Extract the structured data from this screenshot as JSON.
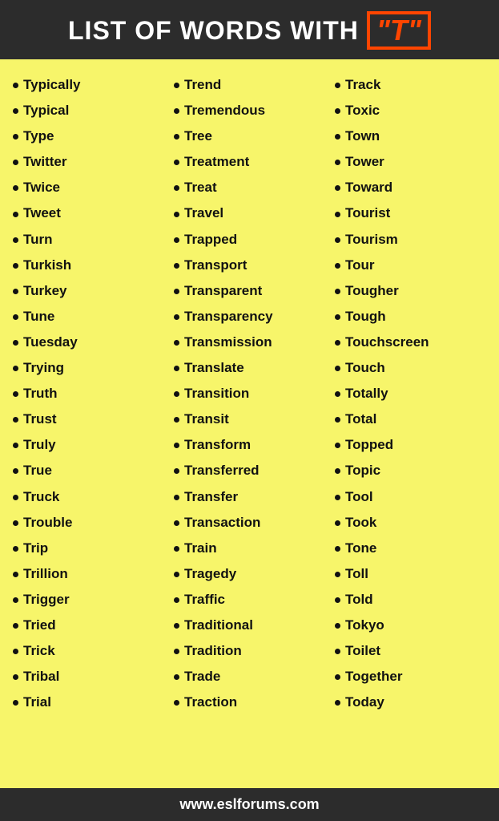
{
  "header": {
    "title": "LIST OF WORDS WITH",
    "letter": "\"T\""
  },
  "columns": [
    {
      "words": [
        "Typically",
        "Typical",
        "Type",
        "Twitter",
        "Twice",
        "Tweet",
        "Turn",
        "Turkish",
        "Turkey",
        "Tune",
        "Tuesday",
        "Trying",
        "Truth",
        "Trust",
        "Truly",
        "True",
        "Truck",
        "Trouble",
        "Trip",
        "Trillion",
        "Trigger",
        "Tried",
        "Trick",
        "Tribal",
        "Trial"
      ]
    },
    {
      "words": [
        "Trend",
        "Tremendous",
        "Tree",
        "Treatment",
        "Treat",
        "Travel",
        "Trapped",
        "Transport",
        "Transparent",
        "Transparency",
        "Transmission",
        "Translate",
        "Transition",
        "Transit",
        "Transform",
        "Transferred",
        "Transfer",
        "Transaction",
        "Train",
        "Tragedy",
        "Traffic",
        "Traditional",
        "Tradition",
        "Trade",
        "Traction"
      ]
    },
    {
      "words": [
        "Track",
        "Toxic",
        "Town",
        "Tower",
        "Toward",
        "Tourist",
        "Tourism",
        "Tour",
        "Tougher",
        "Tough",
        "Touchscreen",
        "Touch",
        "Totally",
        "Total",
        "Topped",
        "Topic",
        "Tool",
        "Took",
        "Tone",
        "Toll",
        "Told",
        "Tokyo",
        "Toilet",
        "Together",
        "Today"
      ]
    }
  ],
  "watermarks": [
    "www.eslforums.com",
    "www.eslforums.com",
    "www.eslforums.com"
  ],
  "footer": {
    "url": "www.eslforums.com"
  }
}
